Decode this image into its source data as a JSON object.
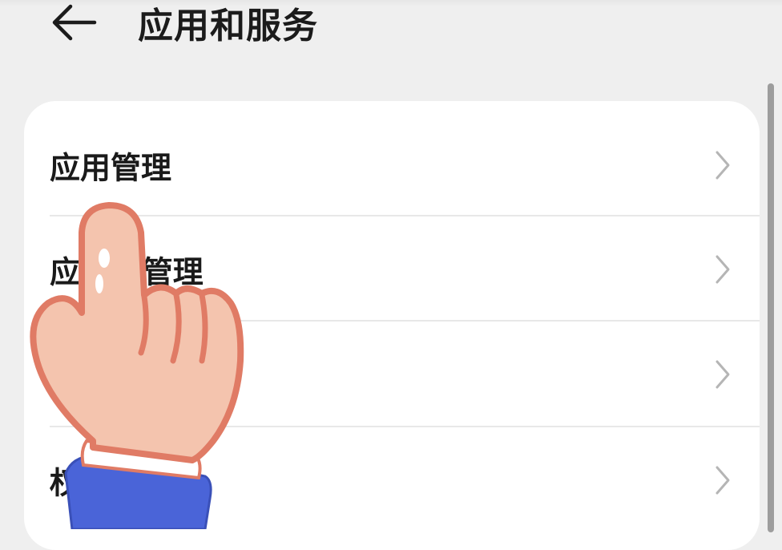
{
  "header": {
    "title": "应用和服务",
    "back_icon": "back-arrow-icon"
  },
  "menu": {
    "items": [
      {
        "label": "应用管理",
        "chevron": "chevron-right-icon"
      },
      {
        "label": "应   动管理",
        "chevron": "chevron-right-icon"
      },
      {
        "label": "",
        "chevron": "chevron-right-icon"
      },
      {
        "label": "权",
        "chevron": "chevron-right-icon"
      }
    ]
  },
  "overlay": {
    "icon": "pointing-hand-icon"
  },
  "colors": {
    "background": "#efefef",
    "card": "#ffffff",
    "text": "#1a1a1a",
    "chevron": "#b5b5b5",
    "sleeve": "#4a64d8",
    "skin": "#f4c4ae",
    "outline": "#e07b65"
  }
}
